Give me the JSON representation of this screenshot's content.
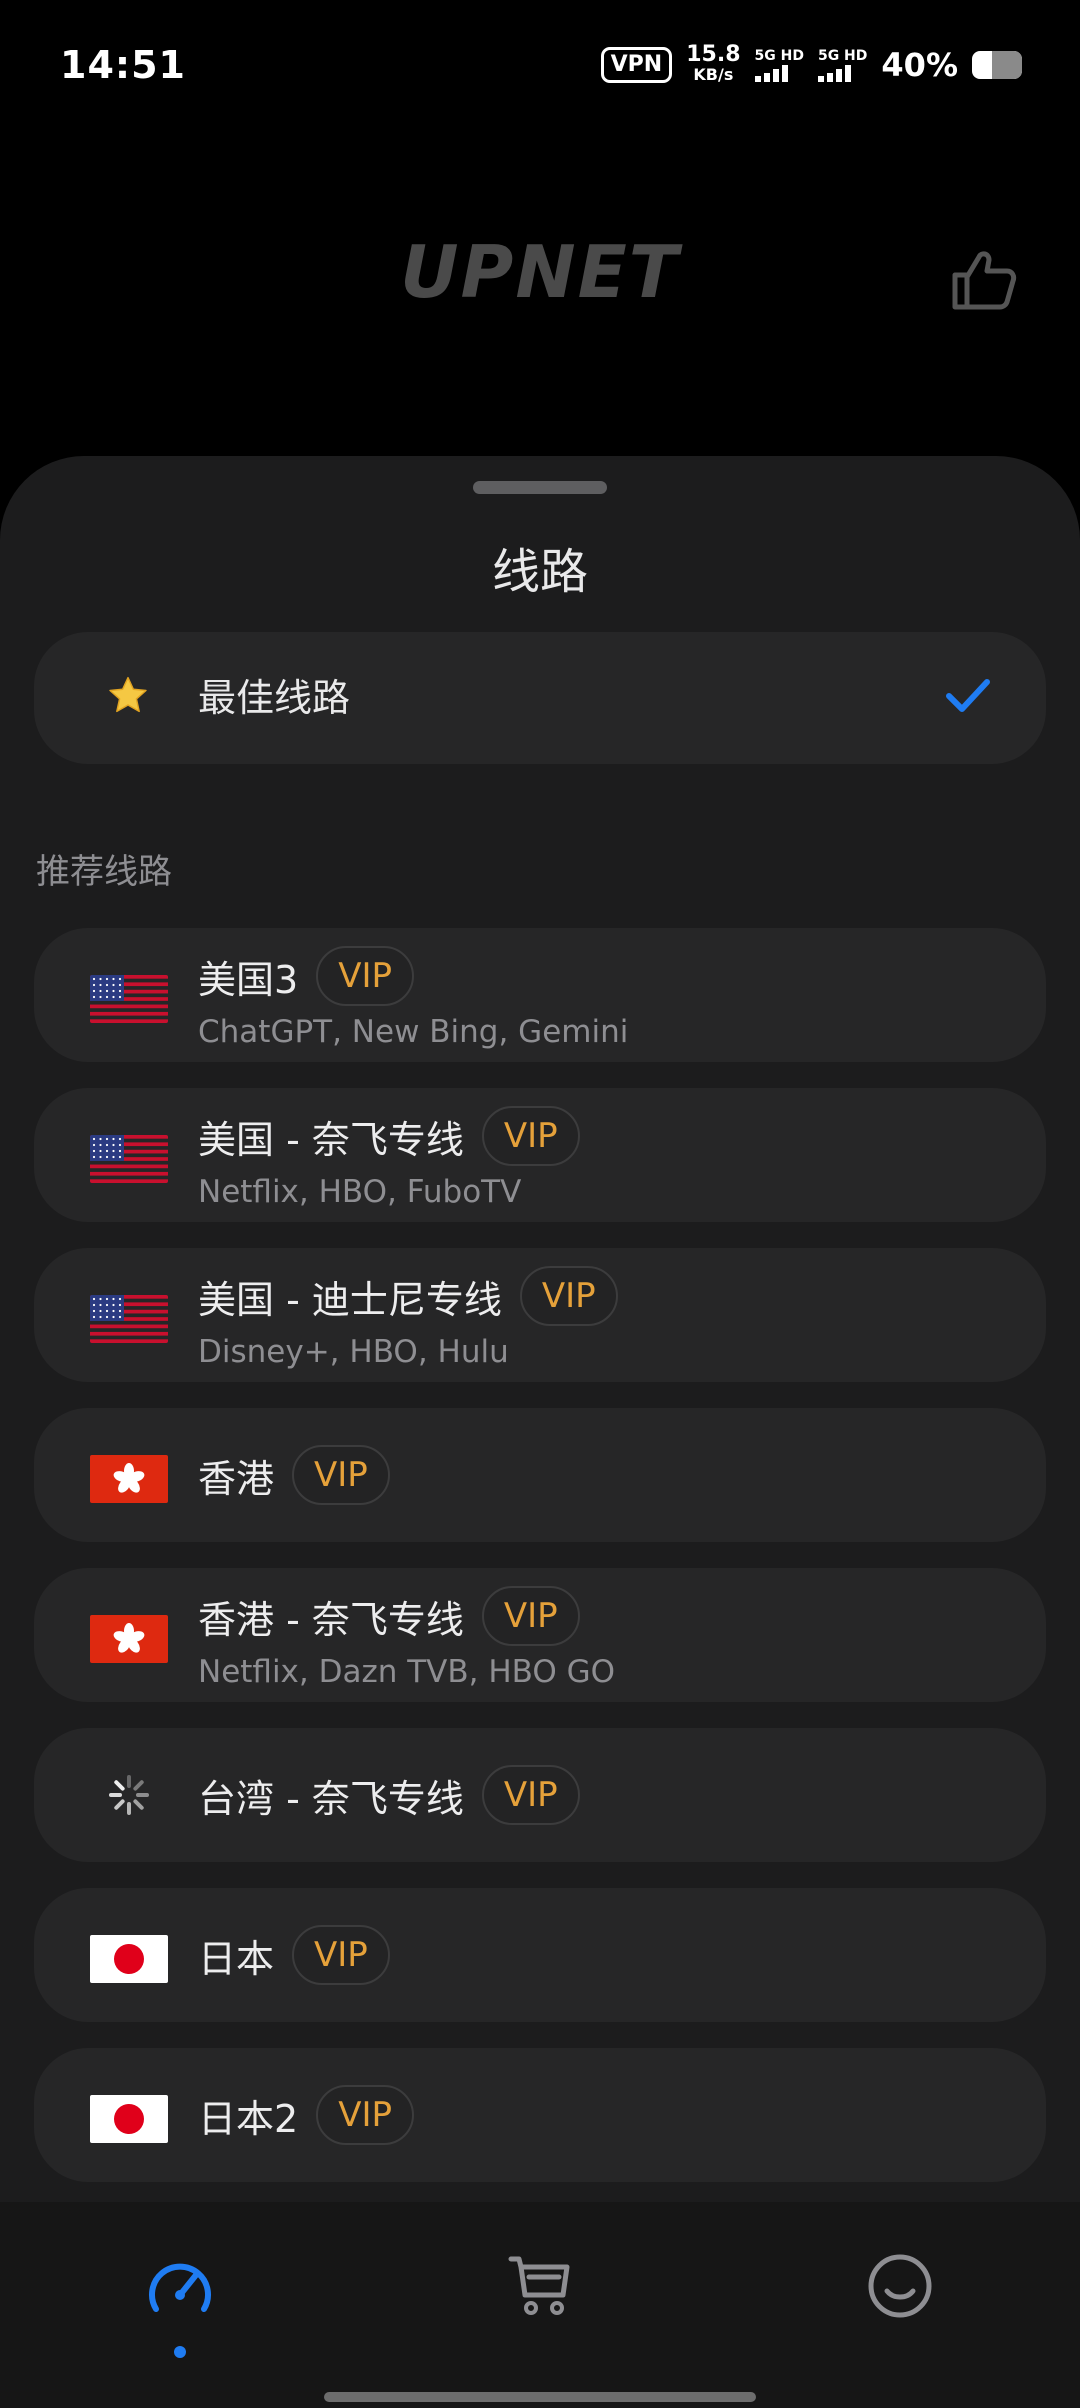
{
  "status_bar": {
    "time": "14:51",
    "vpn": "VPN",
    "net_speed_value": "15.8",
    "net_speed_unit": "KB/s",
    "sim1_label": "5G HD",
    "sim2_label": "5G HD",
    "battery_percent": "40%",
    "battery_level": 0.4
  },
  "header": {
    "logo": "UPNET",
    "thumb_icon": "thumbs-up-icon"
  },
  "sheet": {
    "title": "线路",
    "best_route": {
      "icon": "star-icon",
      "label": "最佳线路",
      "selected": true
    },
    "section_label": "推荐线路",
    "routes": [
      {
        "flag": "us",
        "name": "美国3",
        "badge": "VIP",
        "sub": "ChatGPT, New Bing, Gemini"
      },
      {
        "flag": "us",
        "name": "美国 - 奈飞专线",
        "badge": "VIP",
        "sub": "Netflix, HBO, FuboTV"
      },
      {
        "flag": "us",
        "name": "美国 - 迪士尼专线",
        "badge": "VIP",
        "sub": "Disney+, HBO, Hulu"
      },
      {
        "flag": "hk",
        "name": "香港",
        "badge": "VIP",
        "sub": ""
      },
      {
        "flag": "hk",
        "name": "香港 - 奈飞专线",
        "badge": "VIP",
        "sub": "Netflix, Dazn TVB, HBO GO"
      },
      {
        "flag": "loading",
        "name": "台湾 - 奈飞专线",
        "badge": "VIP",
        "sub": ""
      },
      {
        "flag": "jp",
        "name": "日本",
        "badge": "VIP",
        "sub": ""
      },
      {
        "flag": "jp",
        "name": "日本2",
        "badge": "VIP",
        "sub": ""
      }
    ]
  },
  "bottom_nav": {
    "items": [
      {
        "icon": "speedometer-icon",
        "active": true
      },
      {
        "icon": "cart-icon",
        "active": false
      },
      {
        "icon": "smiley-icon",
        "active": false
      }
    ],
    "accent": "#1f7cf2"
  }
}
